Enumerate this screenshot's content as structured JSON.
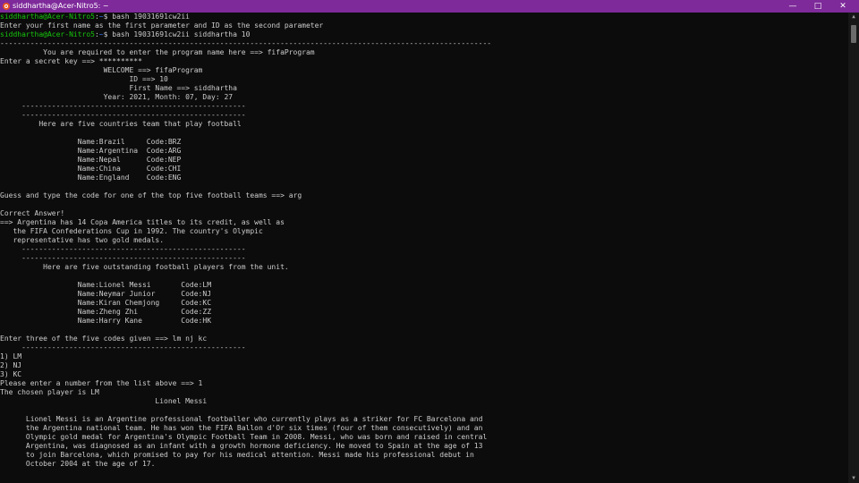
{
  "window": {
    "title": "siddhartha@Acer-Nitro5: ~",
    "icon": "ubuntu-icon",
    "controls": {
      "minimize": "—",
      "maximize": "□",
      "close": "✕"
    }
  },
  "colors": {
    "titlebar": "#7e2a9a",
    "background": "#0c0c0c",
    "text": "#cccccc",
    "prompt_user": "#16c60c",
    "prompt_path": "#3b78ff"
  },
  "prompts": [
    {
      "user": "siddhartha@Acer-Nitro5",
      "sep": ":",
      "path": "~",
      "sym": "$ ",
      "cmd": "bash 19031691cw2ii"
    },
    {
      "user": "siddhartha@Acer-Nitro5",
      "sep": ":",
      "path": "~",
      "sym": "$ ",
      "cmd": "bash 19031691cw2ii siddhartha 10"
    }
  ],
  "out": [
    "Enter your first name as the first parameter and ID as the second parameter",
    "------------------------------------------------------------------------------------------------------------------",
    "          You are required to enter the program name here ==> fifaProgram",
    "Enter a secret key ==> **********",
    "                        WELCOME ==> fifaProgram",
    "                              ID ==> 10",
    "                              First Name ==> siddhartha",
    "                        Year: 2021, Month: 07, Day: 27",
    "     ----------------------------------------------------",
    "     ----------------------------------------------------",
    "         Here are five countries team that play football",
    "",
    "                  Name:Brazil     Code:BRZ",
    "                  Name:Argentina  Code:ARG",
    "                  Name:Nepal      Code:NEP",
    "                  Name:China      Code:CHI",
    "                  Name:England    Code:ENG",
    "",
    "Guess and type the code for one of the top five football teams ==> arg",
    "",
    "Correct Answer!",
    "==> Argentina has 14 Copa America titles to its credit, as well as",
    "   the FIFA Confederations Cup in 1992. The country's Olympic",
    "   representative has two gold medals.",
    "     ----------------------------------------------------",
    "     ----------------------------------------------------",
    "          Here are five outstanding football players from the unit.",
    "",
    "                  Name:Lionel Messi       Code:LM",
    "                  Name:Neymar Junior      Code:NJ",
    "                  Name:Kiran Chemjong     Code:KC",
    "                  Name:Zheng Zhi          Code:ZZ",
    "                  Name:Harry Kane         Code:HK",
    "",
    "Enter three of the five codes given ==> lm nj kc",
    "     ----------------------------------------------------",
    "1) LM",
    "2) NJ",
    "3) KC",
    "Please enter a number from the list above ==> 1",
    "The chosen player is LM",
    "                                    Lionel Messi",
    "",
    "      Lionel Messi is an Argentine professional footballer who currently plays as a striker for FC Barcelona and",
    "      the Argentina national team. He has won the FIFA Ballon d'Or six times (four of them consecutively) and an",
    "      Olympic gold medal for Argentina's Olympic Football Team in 2008. Messi, who was born and raised in central",
    "      Argentina, was diagnosed as an infant with a growth hormone deficiency. He moved to Spain at the age of 13",
    "      to join Barcelona, which promised to pay for his medical attention. Messi made his professional debut in",
    "      October 2004 at the age of 17."
  ]
}
